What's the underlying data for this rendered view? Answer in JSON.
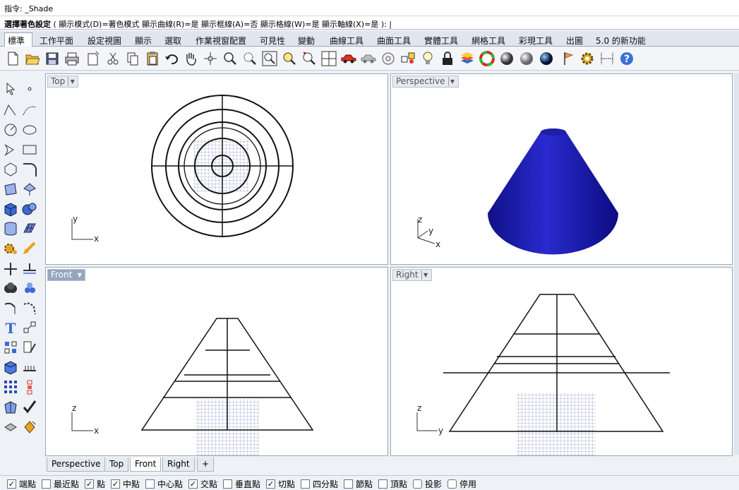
{
  "command": {
    "history_line": "指令: _Shade",
    "prompt_bold": "選擇著色設定",
    "prompt_rest": " ( 顯示模式(D)=著色模式  顯示曲線(R)=是  顯示框線(A)=否  顯示格線(W)=是  顯示軸線(X)=是 ): |"
  },
  "tabs": [
    {
      "label": "標準",
      "active": true
    },
    {
      "label": "工作平面"
    },
    {
      "label": "設定視圖"
    },
    {
      "label": "顯示"
    },
    {
      "label": "選取"
    },
    {
      "label": "作業視窗配置"
    },
    {
      "label": "可見性"
    },
    {
      "label": "變動"
    },
    {
      "label": "曲線工具"
    },
    {
      "label": "曲面工具"
    },
    {
      "label": "實體工具"
    },
    {
      "label": "網格工具"
    },
    {
      "label": "彩現工具"
    },
    {
      "label": "出圖"
    },
    {
      "label": "5.0 的新功能"
    }
  ],
  "toolbar_icons": [
    "new-icon",
    "open-icon",
    "save-icon",
    "print-icon",
    "import-icon",
    "cut-icon",
    "copy-icon",
    "paste-icon",
    "undo-icon",
    "pan-hand-icon",
    "rotate-view-icon",
    "zoom-icon",
    "zoom-window-icon",
    "zoom-extents-icon",
    "zoom-selected-icon",
    "rotate-icon",
    "four-viewports-icon",
    "car-icon",
    "car-gray-icon",
    "target-icon",
    "named-views-icon",
    "light-icon",
    "lock-icon",
    "layers-icon",
    "color-wheel-icon",
    "sphere-dark-icon",
    "sphere-gray-icon",
    "sphere-blue-icon",
    "flag-icon",
    "gear-icon",
    "dimension-icon",
    "help-icon"
  ],
  "viewports": {
    "top": {
      "title": "Top",
      "axes": [
        "y",
        "x"
      ]
    },
    "perspective": {
      "title": "Perspective",
      "axes": [
        "z",
        "y",
        "x"
      ],
      "cone_color": "#1a1aa8"
    },
    "front": {
      "title": "Front",
      "axes": [
        "z",
        "x"
      ]
    },
    "right": {
      "title": "Right",
      "axes": [
        "z",
        "y"
      ]
    }
  },
  "viewport_tabs": [
    {
      "label": "Perspective"
    },
    {
      "label": "Top"
    },
    {
      "label": "Front",
      "active": true
    },
    {
      "label": "Right"
    },
    {
      "label": "+"
    }
  ],
  "osnaps": [
    {
      "label": "端點",
      "checked": true
    },
    {
      "label": "最近點",
      "checked": false
    },
    {
      "label": "點",
      "checked": true
    },
    {
      "label": "中點",
      "checked": true
    },
    {
      "label": "中心點",
      "checked": false
    },
    {
      "label": "交點",
      "checked": true
    },
    {
      "label": "垂直點",
      "checked": false
    },
    {
      "label": "切點",
      "checked": true
    },
    {
      "label": "四分點",
      "checked": false
    },
    {
      "label": "節點",
      "checked": false
    },
    {
      "label": "頂點",
      "checked": false
    },
    {
      "label": "投影",
      "checked": false
    },
    {
      "label": "停用",
      "checked": false
    }
  ]
}
